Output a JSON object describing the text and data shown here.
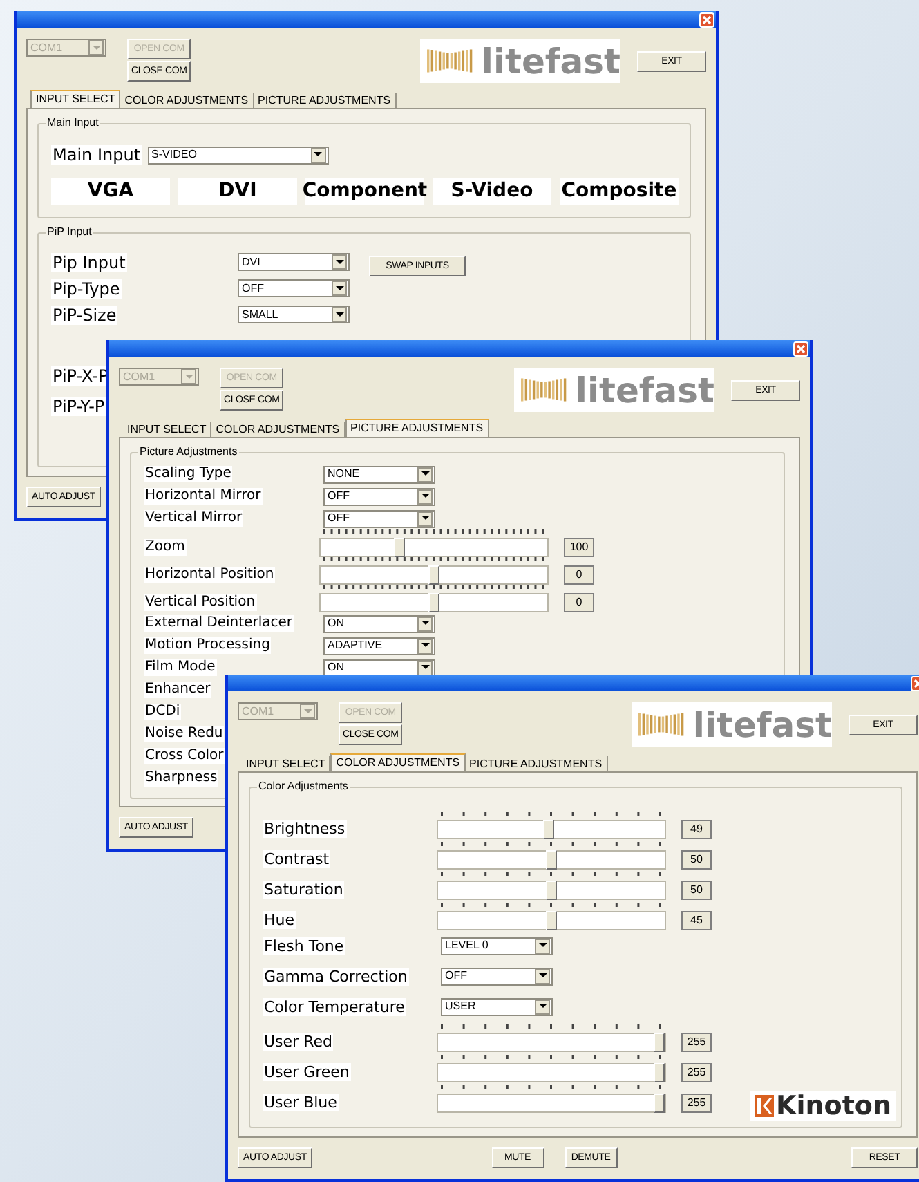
{
  "windows": [
    {
      "com_port": {
        "value": "COM1",
        "disabled": true
      },
      "open_com": {
        "label": "OPEN COM",
        "disabled": true
      },
      "close_com": {
        "label": "CLOSE COM",
        "disabled": false
      },
      "logo": "litefast",
      "exit": "EXIT",
      "tabs": [
        {
          "label": "INPUT SELECT",
          "selected": true
        },
        {
          "label": "COLOR ADJUSTMENTS",
          "selected": false
        },
        {
          "label": "PICTURE ADJUSTMENTS",
          "selected": false
        }
      ],
      "groups": [
        {
          "title": "Main Input",
          "rows": [
            {
              "kind": "inline_select",
              "label": "Main Input",
              "value": "S-VIDEO"
            },
            {
              "kind": "sources",
              "items": [
                "VGA",
                "DVI",
                "Component",
                "S-Video",
                "Composite"
              ]
            }
          ]
        },
        {
          "title": "PiP Input",
          "rows": [
            {
              "kind": "select",
              "label": "Pip Input",
              "value": "DVI",
              "button": "SWAP INPUTS"
            },
            {
              "kind": "select",
              "label": "Pip-Type",
              "value": "OFF"
            },
            {
              "kind": "select",
              "label": "PiP-Size",
              "value": "SMALL"
            },
            {
              "kind": "label",
              "label": "PiP-X-P"
            },
            {
              "kind": "label",
              "label": "PiP-Y-P"
            }
          ]
        }
      ],
      "footer": [
        "AUTO ADJUST"
      ]
    },
    {
      "com_port": {
        "value": "COM1",
        "disabled": true
      },
      "open_com": {
        "label": "OPEN COM",
        "disabled": true
      },
      "close_com": {
        "label": "CLOSE COM",
        "disabled": false
      },
      "logo": "litefast",
      "exit": "EXIT",
      "tabs": [
        {
          "label": "INPUT SELECT",
          "selected": false
        },
        {
          "label": "COLOR ADJUSTMENTS",
          "selected": false
        },
        {
          "label": "PICTURE ADJUSTMENTS",
          "selected": true
        }
      ],
      "groups": [
        {
          "title": "Picture Adjustments",
          "rows": [
            {
              "kind": "select",
              "label": "Scaling Type",
              "value": "NONE"
            },
            {
              "kind": "select",
              "label": "Horizontal Mirror",
              "value": "OFF"
            },
            {
              "kind": "select",
              "label": "Vertical Mirror",
              "value": "OFF"
            },
            {
              "kind": "slider",
              "label": "Zoom",
              "level": 0.34,
              "reading": "100"
            },
            {
              "kind": "slider",
              "label": "Horizontal Position",
              "level": 0.5,
              "reading": "0"
            },
            {
              "kind": "slider",
              "label": "Vertical Position",
              "level": 0.5,
              "reading": "0"
            },
            {
              "kind": "select",
              "label": "External Deinterlacer",
              "value": "ON"
            },
            {
              "kind": "select",
              "label": "Motion Processing",
              "value": "ADAPTIVE"
            },
            {
              "kind": "select",
              "label": "Film Mode",
              "value": "ON"
            },
            {
              "kind": "label",
              "label": "Enhancer"
            },
            {
              "kind": "label",
              "label": "DCDi"
            },
            {
              "kind": "label",
              "label": "Noise Redu"
            },
            {
              "kind": "label",
              "label": "Cross Color"
            },
            {
              "kind": "label",
              "label": "Sharpness"
            }
          ]
        }
      ],
      "footer": [
        "AUTO ADJUST"
      ]
    },
    {
      "com_port": {
        "value": "COM1",
        "disabled": true
      },
      "open_com": {
        "label": "OPEN COM",
        "disabled": true
      },
      "close_com": {
        "label": "CLOSE COM",
        "disabled": false
      },
      "logo": "litefast",
      "exit": "EXIT",
      "tabs": [
        {
          "label": "INPUT SELECT",
          "selected": false
        },
        {
          "label": "COLOR ADJUSTMENTS",
          "selected": true
        },
        {
          "label": "PICTURE ADJUSTMENTS",
          "selected": false
        }
      ],
      "groups": [
        {
          "title": "Color Adjustments",
          "brand": "Kinoton",
          "rows": [
            {
              "kind": "slider",
              "label": "Brightness",
              "level": 0.49,
              "reading": "49"
            },
            {
              "kind": "slider",
              "label": "Contrast",
              "level": 0.5,
              "reading": "50"
            },
            {
              "kind": "slider",
              "label": "Saturation",
              "level": 0.5,
              "reading": "50"
            },
            {
              "kind": "slider",
              "label": "Hue",
              "level": 0.5,
              "reading": "45"
            },
            {
              "kind": "select",
              "label": "Flesh Tone",
              "value": "LEVEL 0"
            },
            {
              "kind": "select",
              "label": "Gamma Correction",
              "value": "OFF"
            },
            {
              "kind": "select",
              "label": "Color Temperature",
              "value": "USER"
            },
            {
              "kind": "slider",
              "label": "User Red",
              "level": 1,
              "reading": "255"
            },
            {
              "kind": "slider",
              "label": "User Green",
              "level": 1,
              "reading": "255"
            },
            {
              "kind": "slider",
              "label": "User Blue",
              "level": 1,
              "reading": "255"
            }
          ]
        }
      ],
      "footer": [
        "AUTO ADJUST",
        "MUTE",
        "DEMUTE",
        "RESET"
      ]
    }
  ]
}
